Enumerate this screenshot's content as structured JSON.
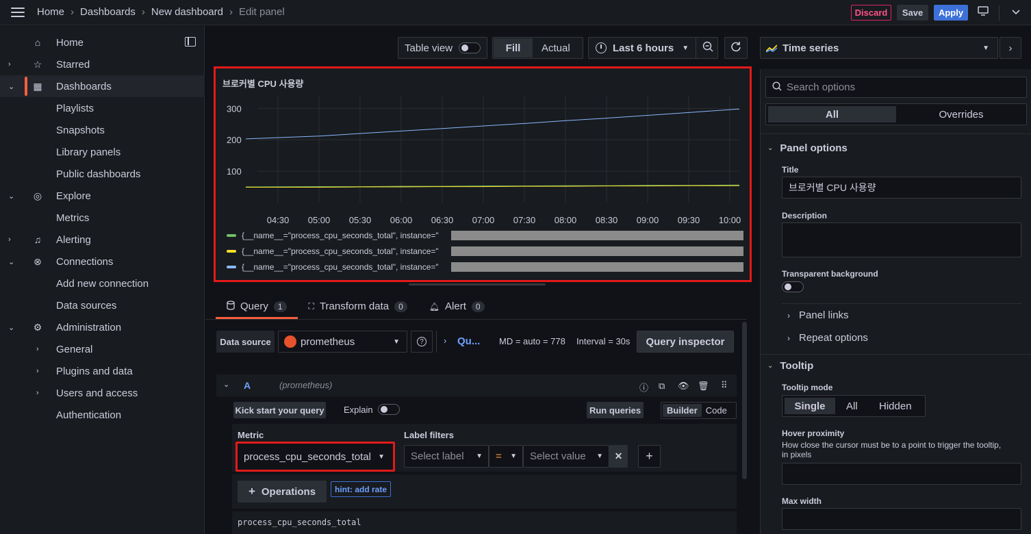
{
  "breadcrumb": {
    "home": "Home",
    "dashboards": "Dashboards",
    "new_dashboard": "New dashboard",
    "edit_panel": "Edit panel"
  },
  "actions": {
    "discard": "Discard",
    "save": "Save",
    "apply": "Apply"
  },
  "sidebar": {
    "items": [
      {
        "label": "Home",
        "icon": "home-icon",
        "chevron": ""
      },
      {
        "label": "Starred",
        "icon": "star-icon",
        "chevron": "›"
      },
      {
        "label": "Dashboards",
        "icon": "apps-icon",
        "chevron": "⌄"
      },
      {
        "label": "Playlists"
      },
      {
        "label": "Snapshots"
      },
      {
        "label": "Library panels"
      },
      {
        "label": "Public dashboards"
      },
      {
        "label": "Explore",
        "icon": "compass-icon",
        "chevron": "⌄"
      },
      {
        "label": "Metrics"
      },
      {
        "label": "Alerting",
        "icon": "bell-icon",
        "chevron": "›"
      },
      {
        "label": "Connections",
        "icon": "plug-icon",
        "chevron": "⌄"
      },
      {
        "label": "Add new connection"
      },
      {
        "label": "Data sources"
      },
      {
        "label": "Administration",
        "icon": "gear-icon",
        "chevron": "⌄"
      },
      {
        "label": "General",
        "chevron": "›"
      },
      {
        "label": "Plugins and data",
        "chevron": "›"
      },
      {
        "label": "Users and access",
        "chevron": "›"
      },
      {
        "label": "Authentication"
      }
    ]
  },
  "toolbar": {
    "table_view": "Table view",
    "fill": "Fill",
    "actual": "Actual",
    "time_range": "Last 6 hours"
  },
  "panel": {
    "title": "브로커별 CPU 사용량"
  },
  "chart_data": {
    "type": "line",
    "title": "브로커별 CPU 사용량",
    "x": [
      "04:30",
      "05:00",
      "05:30",
      "06:00",
      "06:30",
      "07:00",
      "07:30",
      "08:00",
      "08:30",
      "09:00",
      "09:30",
      "10:00"
    ],
    "yticks": [
      100,
      200,
      300
    ],
    "ylim": [
      0,
      340
    ],
    "series": [
      {
        "name": "{__name__=\"process_cpu_seconds_total\", instance=\"",
        "color": "#73bf69",
        "values": [
          50,
          51,
          51,
          52,
          52,
          53,
          53,
          54,
          54,
          55,
          55,
          56
        ]
      },
      {
        "name": "{__name__=\"process_cpu_seconds_total\", instance=\"",
        "color": "#fade2a",
        "values": [
          49,
          49,
          50,
          50,
          51,
          51,
          52,
          52,
          53,
          53,
          54,
          54
        ]
      },
      {
        "name": "{__name__=\"process_cpu_seconds_total\", instance=\"",
        "color": "#8ab8ff",
        "values": [
          203,
          212,
          220,
          228,
          236,
          244,
          252,
          261,
          269,
          278,
          287,
          298
        ]
      }
    ],
    "grid": true,
    "legend": "bottom"
  },
  "query_tabs": [
    {
      "label": "Query",
      "count": "1"
    },
    {
      "label": "Transform data",
      "count": "0"
    },
    {
      "label": "Alert",
      "count": "0"
    }
  ],
  "query": {
    "data_source_label": "Data source",
    "data_source": "prometheus",
    "qu": "Qu...",
    "md": "MD = auto = 778",
    "interval": "Interval = 30s",
    "inspector": "Query inspector",
    "ref": "A",
    "ds_hint": "(prometheus)",
    "kick": "Kick start your query",
    "explain": "Explain",
    "run": "Run queries",
    "builder": "Builder",
    "code": "Code",
    "metric_label": "Metric",
    "metric": "process_cpu_seconds_total",
    "label_filters": "Label filters",
    "select_label": "Select label",
    "op": "=",
    "select_value": "Select value",
    "operations": "Operations",
    "hint": "hint: add rate",
    "preview": "process_cpu_seconds_total"
  },
  "right": {
    "viz": "Time series",
    "search_placeholder": "Search options",
    "all": "All",
    "overrides": "Overrides",
    "panel_options": "Panel options",
    "title_label": "Title",
    "title_value": "브로커별 CPU 사용량",
    "description": "Description",
    "transparent": "Transparent background",
    "panel_links": "Panel links",
    "repeat_options": "Repeat options",
    "tooltip": "Tooltip",
    "tooltip_mode": "Tooltip mode",
    "single": "Single",
    "all_mode": "All",
    "hidden": "Hidden",
    "hover_prox": "Hover proximity",
    "hover_desc": "How close the cursor must be to a point to trigger the tooltip, in pixels",
    "max_width": "Max width"
  }
}
